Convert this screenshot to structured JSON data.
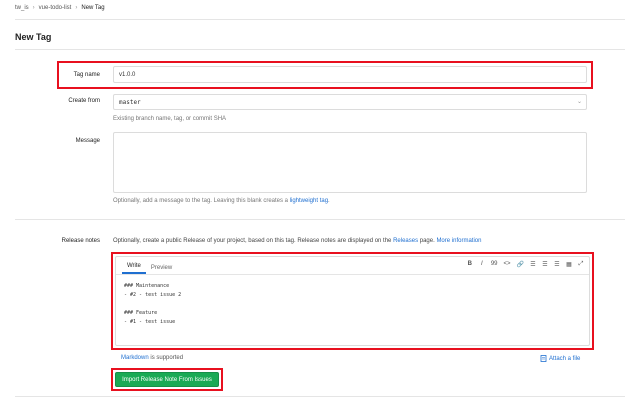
{
  "breadcrumb": {
    "items": [
      "tw_is",
      "vue-todo-list",
      "New Tag"
    ],
    "separator": "›"
  },
  "page": {
    "title": "New Tag"
  },
  "form": {
    "tag_name": {
      "label": "Tag name",
      "value": "v1.0.0"
    },
    "create_from": {
      "label": "Create from",
      "value": "master",
      "hint": "Existing branch name, tag, or commit SHA"
    },
    "message": {
      "label": "Message",
      "value": "",
      "hint_prefix": "Optionally, add a message to the tag. Leaving this blank creates a",
      "hint_link": "lightweight tag",
      "hint_suffix": "."
    },
    "release_notes": {
      "label": "Release notes",
      "intro_prefix": "Optionally, create a public Release of your project, based on this tag. Release notes are displayed on the",
      "intro_link": "Releases",
      "intro_mid": "page.",
      "intro_more": "More information",
      "tabs": [
        "Write",
        "Preview"
      ],
      "toolbar": [
        "B",
        "I",
        "99",
        "<>",
        "🔗",
        "☰",
        "☰",
        "☰",
        "▦",
        "⤢"
      ],
      "content": "### Maintenance\n- #2 - test issue 2\n\n### Feature\n- #1 - test issue",
      "markdown_link": "Markdown",
      "markdown_suffix": "is supported",
      "attach_label": "Attach a file"
    },
    "import_button": "Import Release Note From Issues"
  },
  "colors": {
    "highlight": "#e8101f",
    "link": "#1f6fd0",
    "primary_button": "#1aaa55"
  }
}
